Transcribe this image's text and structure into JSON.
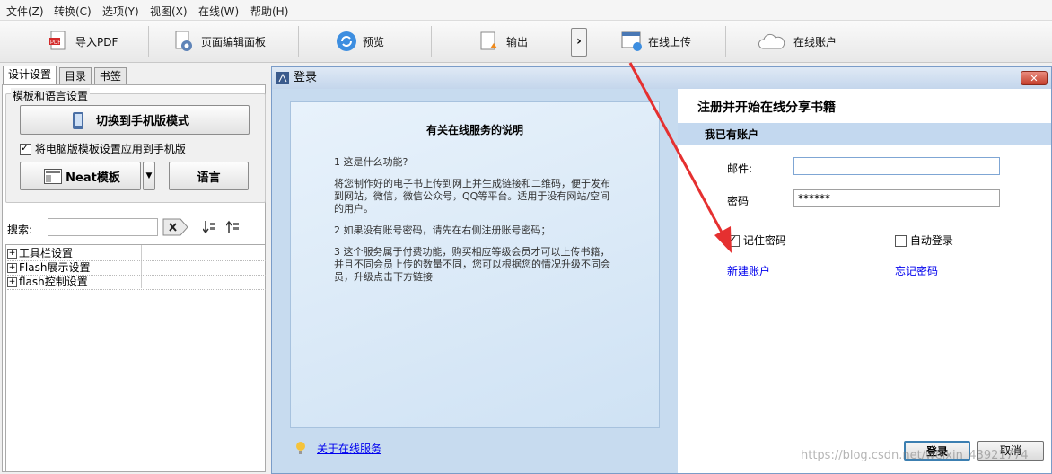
{
  "menu": [
    "文件(Z)",
    "转换(C)",
    "选项(Y)",
    "视图(X)",
    "在线(W)",
    "帮助(H)"
  ],
  "toolbar": {
    "import_pdf": "导入PDF",
    "page_editor": "页面编辑面板",
    "preview": "预览",
    "output": "输出",
    "upload_online": "在线上传",
    "online_account": "在线账户"
  },
  "left": {
    "tabs": [
      "设计设置",
      "目录",
      "书签"
    ],
    "group_title": "模板和语言设置",
    "switch_mobile": "切换到手机版模式",
    "apply_mobile": "将电脑版模板设置应用到手机版",
    "neat_template": "Neat模板",
    "language": "语言",
    "search_label": "搜索:",
    "tree": [
      "工具栏设置",
      "Flash展示设置",
      "flash控制设置"
    ]
  },
  "dialog": {
    "title": "登录",
    "info_title": "有关在线服务的说明",
    "info_paragraphs": [
      "1 这是什么功能?",
      "将您制作好的电子书上传到网上并生成链接和二维码，便于发布到网站，微信，微信公众号，QQ等平台。适用于没有网站/空间的用户。",
      "2 如果没有账号密码，请先在右侧注册账号密码；",
      "3 这个服务属于付费功能，购买相应等级会员才可以上传书籍，并且不同会员上传的数量不同，您可以根据您的情况升级不同会员，升级点击下方链接"
    ],
    "about_link": "关于在线服务",
    "header": "注册并开始在线分享书籍",
    "have_account": "我已有账户",
    "email_label": "邮件:",
    "email_value": "",
    "password_label": "密码",
    "password_value": "******",
    "remember": "记住密码",
    "auto_login": "自动登录",
    "new_account": "新建账户",
    "forgot": "忘记密码",
    "login_btn": "登录",
    "cancel_btn": "取消"
  },
  "watermark": "https://blog.csdn.net/weixin_43921774",
  "colors": {
    "annotation_arrow": "#e53030",
    "dialog_frame": "#c7dbef",
    "section_bar": "#c3d8ef"
  }
}
